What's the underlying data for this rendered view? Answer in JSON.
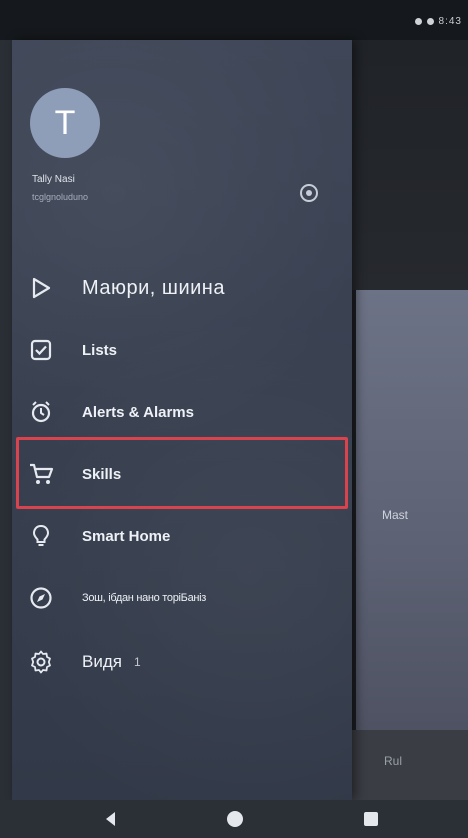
{
  "status_bar": {
    "time": "8:43"
  },
  "drawer": {
    "avatar_initial": "T",
    "user_name": "Tally Nasi",
    "user_email": "tcglgnoluduno",
    "menu": [
      {
        "label": "Маюри, шиина",
        "icon": "play-icon"
      },
      {
        "label": "Lists",
        "icon": "checklist-icon"
      },
      {
        "label": "Alerts & Alarms",
        "icon": "alarm-icon"
      },
      {
        "label": "Skills",
        "icon": "cart-icon",
        "highlighted": true
      },
      {
        "label": "Smart Home",
        "icon": "bulb-icon"
      },
      {
        "label": "Зош, ібдан нано торіБаніз",
        "icon": "compass-icon"
      },
      {
        "label": "Видя",
        "badge": "1",
        "icon": "gear-icon"
      }
    ]
  },
  "background_app": {
    "card_label": "Mast",
    "bottom_label": "Rul"
  },
  "colors": {
    "drawer_bg": "#3b4354",
    "highlight_border": "#d8434e",
    "avatar_bg": "#8e9db8"
  }
}
